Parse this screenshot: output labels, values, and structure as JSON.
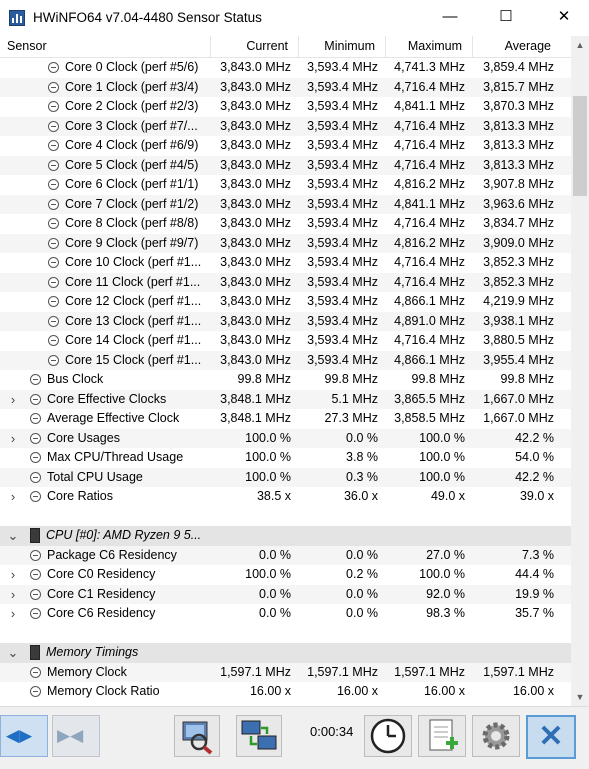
{
  "window": {
    "title": "HWiNFO64 v7.04-4480 Sensor Status",
    "minimize_glyph": "—",
    "maximize_glyph": "☐",
    "close_glyph": "✕"
  },
  "columns": [
    "Sensor",
    "Current",
    "Minimum",
    "Maximum",
    "Average"
  ],
  "rows": [
    {
      "type": "sensor",
      "indent": 2,
      "label": "Core 0 Clock (perf #5/6)",
      "values": [
        "3,843.0 MHz",
        "3,593.4 MHz",
        "4,741.3 MHz",
        "3,859.4 MHz"
      ]
    },
    {
      "type": "sensor",
      "indent": 2,
      "label": "Core 1 Clock (perf #3/4)",
      "values": [
        "3,843.0 MHz",
        "3,593.4 MHz",
        "4,716.4 MHz",
        "3,815.7 MHz"
      ]
    },
    {
      "type": "sensor",
      "indent": 2,
      "label": "Core 2 Clock (perf #2/3)",
      "values": [
        "3,843.0 MHz",
        "3,593.4 MHz",
        "4,841.1 MHz",
        "3,870.3 MHz"
      ]
    },
    {
      "type": "sensor",
      "indent": 2,
      "label": "Core 3 Clock (perf #7/...",
      "values": [
        "3,843.0 MHz",
        "3,593.4 MHz",
        "4,716.4 MHz",
        "3,813.3 MHz"
      ]
    },
    {
      "type": "sensor",
      "indent": 2,
      "label": "Core 4 Clock (perf #6/9)",
      "values": [
        "3,843.0 MHz",
        "3,593.4 MHz",
        "4,716.4 MHz",
        "3,813.3 MHz"
      ]
    },
    {
      "type": "sensor",
      "indent": 2,
      "label": "Core 5 Clock (perf #4/5)",
      "values": [
        "3,843.0 MHz",
        "3,593.4 MHz",
        "4,716.4 MHz",
        "3,813.3 MHz"
      ]
    },
    {
      "type": "sensor",
      "indent": 2,
      "label": "Core 6 Clock (perf #1/1)",
      "values": [
        "3,843.0 MHz",
        "3,593.4 MHz",
        "4,816.2 MHz",
        "3,907.8 MHz"
      ]
    },
    {
      "type": "sensor",
      "indent": 2,
      "label": "Core 7 Clock (perf #1/2)",
      "values": [
        "3,843.0 MHz",
        "3,593.4 MHz",
        "4,841.1 MHz",
        "3,963.6 MHz"
      ]
    },
    {
      "type": "sensor",
      "indent": 2,
      "label": "Core 8 Clock (perf #8/8)",
      "values": [
        "3,843.0 MHz",
        "3,593.4 MHz",
        "4,716.4 MHz",
        "3,834.7 MHz"
      ]
    },
    {
      "type": "sensor",
      "indent": 2,
      "label": "Core 9 Clock (perf #9/7)",
      "values": [
        "3,843.0 MHz",
        "3,593.4 MHz",
        "4,816.2 MHz",
        "3,909.0 MHz"
      ]
    },
    {
      "type": "sensor",
      "indent": 2,
      "label": "Core 10 Clock (perf #1...",
      "values": [
        "3,843.0 MHz",
        "3,593.4 MHz",
        "4,716.4 MHz",
        "3,852.3 MHz"
      ]
    },
    {
      "type": "sensor",
      "indent": 2,
      "label": "Core 11 Clock (perf #1...",
      "values": [
        "3,843.0 MHz",
        "3,593.4 MHz",
        "4,716.4 MHz",
        "3,852.3 MHz"
      ]
    },
    {
      "type": "sensor",
      "indent": 2,
      "label": "Core 12 Clock (perf #1...",
      "values": [
        "3,843.0 MHz",
        "3,593.4 MHz",
        "4,866.1 MHz",
        "4,219.9 MHz"
      ]
    },
    {
      "type": "sensor",
      "indent": 2,
      "label": "Core 13 Clock (perf #1...",
      "values": [
        "3,843.0 MHz",
        "3,593.4 MHz",
        "4,891.0 MHz",
        "3,938.1 MHz"
      ]
    },
    {
      "type": "sensor",
      "indent": 2,
      "label": "Core 14 Clock (perf #1...",
      "values": [
        "3,843.0 MHz",
        "3,593.4 MHz",
        "4,716.4 MHz",
        "3,880.5 MHz"
      ]
    },
    {
      "type": "sensor",
      "indent": 2,
      "label": "Core 15 Clock (perf #1...",
      "values": [
        "3,843.0 MHz",
        "3,593.4 MHz",
        "4,866.1 MHz",
        "3,955.4 MHz"
      ]
    },
    {
      "type": "sensor",
      "indent": 1,
      "label": "Bus Clock",
      "values": [
        "99.8 MHz",
        "99.8 MHz",
        "99.8 MHz",
        "99.8 MHz"
      ]
    },
    {
      "type": "sensor",
      "indent": 1,
      "expander": "›",
      "label": "Core Effective Clocks",
      "values": [
        "3,848.1 MHz",
        "5.1 MHz",
        "3,865.5 MHz",
        "1,667.0 MHz"
      ]
    },
    {
      "type": "sensor",
      "indent": 1,
      "label": "Average Effective Clock",
      "values": [
        "3,848.1 MHz",
        "27.3 MHz",
        "3,858.5 MHz",
        "1,667.0 MHz"
      ]
    },
    {
      "type": "sensor",
      "indent": 1,
      "expander": "›",
      "label": "Core Usages",
      "values": [
        "100.0 %",
        "0.0 %",
        "100.0 %",
        "42.2 %"
      ]
    },
    {
      "type": "sensor",
      "indent": 1,
      "label": "Max CPU/Thread Usage",
      "values": [
        "100.0 %",
        "3.8 %",
        "100.0 %",
        "54.0 %"
      ]
    },
    {
      "type": "sensor",
      "indent": 1,
      "label": "Total CPU Usage",
      "values": [
        "100.0 %",
        "0.3 %",
        "100.0 %",
        "42.2 %"
      ]
    },
    {
      "type": "sensor",
      "indent": 1,
      "expander": "›",
      "label": "Core Ratios",
      "values": [
        "38.5 x",
        "36.0 x",
        "49.0 x",
        "39.0 x"
      ]
    },
    {
      "type": "blank"
    },
    {
      "type": "group",
      "label": "CPU [#0]: AMD Ryzen 9 5..."
    },
    {
      "type": "sensor",
      "indent": 1,
      "label": "Package C6 Residency",
      "values": [
        "0.0 %",
        "0.0 %",
        "27.0 %",
        "7.3 %"
      ]
    },
    {
      "type": "sensor",
      "indent": 1,
      "expander": "›",
      "label": "Core C0 Residency",
      "values": [
        "100.0 %",
        "0.2 %",
        "100.0 %",
        "44.4 %"
      ]
    },
    {
      "type": "sensor",
      "indent": 1,
      "expander": "›",
      "label": "Core C1 Residency",
      "values": [
        "0.0 %",
        "0.0 %",
        "92.0 %",
        "19.9 %"
      ]
    },
    {
      "type": "sensor",
      "indent": 1,
      "expander": "›",
      "label": "Core C6 Residency",
      "values": [
        "0.0 %",
        "0.0 %",
        "98.3 %",
        "35.7 %"
      ]
    },
    {
      "type": "blank"
    },
    {
      "type": "group",
      "label": "Memory Timings"
    },
    {
      "type": "sensor",
      "indent": 1,
      "label": "Memory Clock",
      "values": [
        "1,597.1 MHz",
        "1,597.1 MHz",
        "1,597.1 MHz",
        "1,597.1 MHz"
      ]
    },
    {
      "type": "sensor",
      "indent": 1,
      "label": "Memory Clock Ratio",
      "values": [
        "16.00 x",
        "16.00 x",
        "16.00 x",
        "16.00 x"
      ]
    }
  ],
  "toolbar": {
    "timer": "0:00:34"
  }
}
